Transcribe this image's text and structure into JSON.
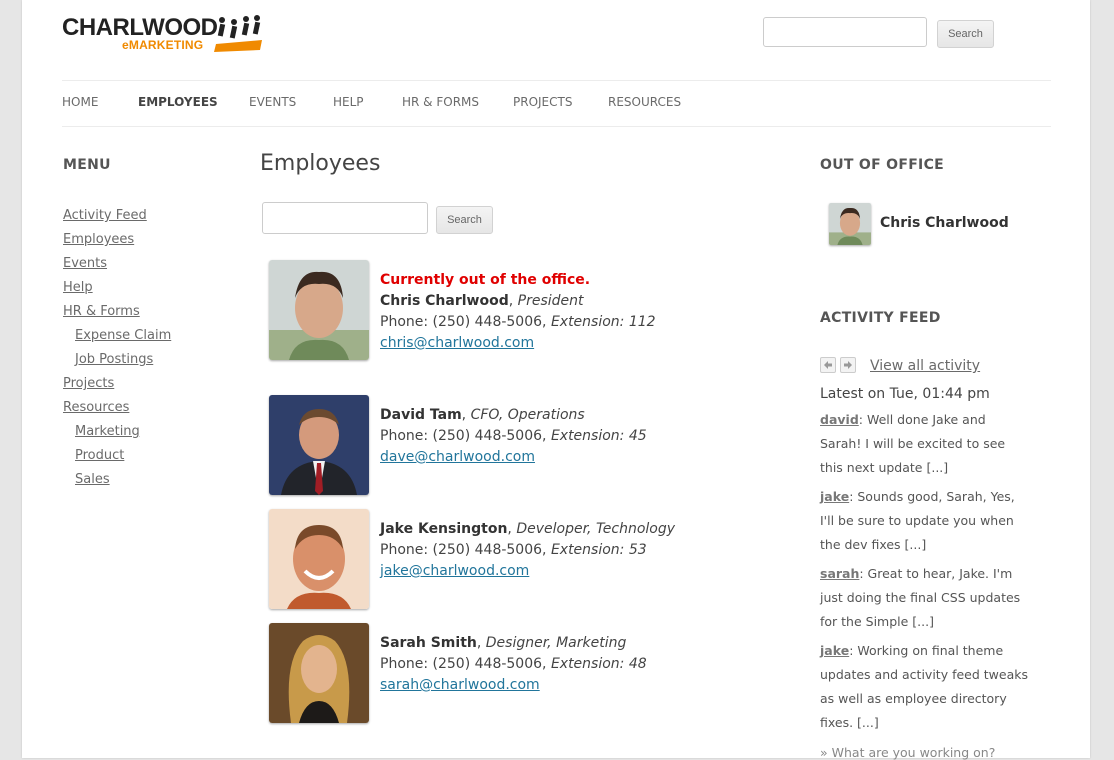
{
  "header": {
    "logo_line1": "CHARLWOOD",
    "logo_line2": "eMARKETING",
    "search_placeholder": "",
    "search_button": "Search"
  },
  "nav": [
    {
      "label": "HOME",
      "active": false
    },
    {
      "label": "EMPLOYEES",
      "active": true
    },
    {
      "label": "EVENTS",
      "active": false
    },
    {
      "label": "HELP",
      "active": false
    },
    {
      "label": "HR & FORMS",
      "active": false
    },
    {
      "label": "PROJECTS",
      "active": false
    },
    {
      "label": "RESOURCES",
      "active": false
    }
  ],
  "sidebar": {
    "title": "MENU",
    "items": [
      {
        "label": "Activity Feed"
      },
      {
        "label": "Employees"
      },
      {
        "label": "Events"
      },
      {
        "label": "Help"
      },
      {
        "label": "HR & Forms"
      },
      {
        "label": "Expense Claim"
      },
      {
        "label": "Job Postings"
      },
      {
        "label": "Projects"
      },
      {
        "label": "Resources"
      },
      {
        "label": "Marketing"
      },
      {
        "label": "Product"
      },
      {
        "label": "Sales"
      }
    ]
  },
  "main": {
    "title": "Employees",
    "search_placeholder": "",
    "search_button": "Search",
    "employees": [
      {
        "status": "Currently out of the office.",
        "name": "Chris Charlwood",
        "role": "President",
        "phone_label": "Phone: (250) 448-5006, ",
        "ext": "Extension: 112",
        "email": "chris@charlwood.com"
      },
      {
        "status": "",
        "name": "David Tam",
        "role": "CFO, Operations",
        "phone_label": "Phone: (250) 448-5006, ",
        "ext": "Extension: 45",
        "email": "dave@charlwood.com"
      },
      {
        "status": "",
        "name": "Jake Kensington",
        "role": "Developer, Technology",
        "phone_label": "Phone: (250) 448-5006, ",
        "ext": "Extension: 53",
        "email": "jake@charlwood.com"
      },
      {
        "status": "",
        "name": "Sarah Smith",
        "role": "Designer, Marketing",
        "phone_label": "Phone: (250) 448-5006, ",
        "ext": "Extension: 48",
        "email": "sarah@charlwood.com"
      }
    ]
  },
  "right": {
    "out_of_office_title": "OUT OF OFFICE",
    "out_of_office_name": "Chris Charlwood",
    "activity_title": "ACTIVITY FEED",
    "view_all": "View all activity",
    "latest": "Latest on Tue, 01:44 pm",
    "feed": [
      {
        "user": "david",
        "text": ": Well done Jake and Sarah! I will be excited to see this next update [...]"
      },
      {
        "user": "jake",
        "text": ": Sounds good, Sarah, Yes, I'll be sure to update you when the dev fixes [...]"
      },
      {
        "user": "sarah",
        "text": ": Great to hear, Jake. I'm just doing the final CSS updates for the Simple [...]"
      },
      {
        "user": "jake",
        "text": ": Working on final theme updates and activity feed tweaks as well as employee directory fixes. [...]"
      }
    ],
    "what_up": "» What are you working on?"
  }
}
